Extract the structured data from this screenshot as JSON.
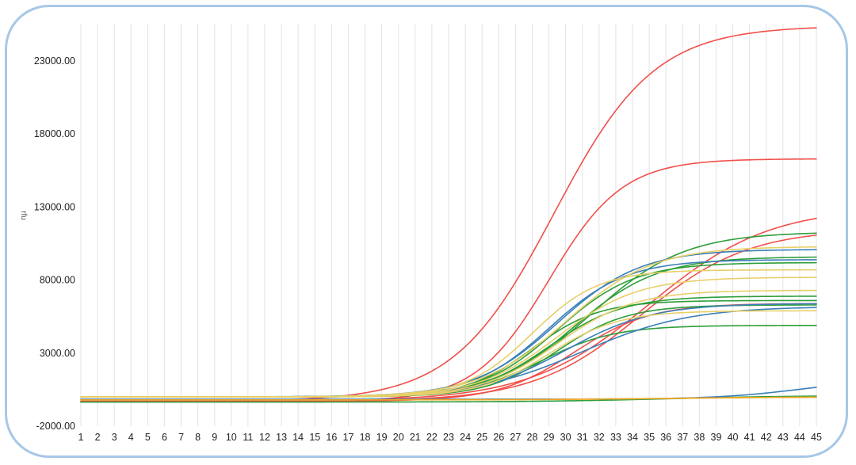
{
  "chart_data": {
    "type": "line",
    "title": "",
    "xlabel": "",
    "ylabel": "rfu",
    "xlim": [
      1,
      45
    ],
    "ylim": [
      -2000,
      25000
    ],
    "y_ticks": [
      "23000.00",
      "18000.00",
      "13000.00",
      "8000.00",
      "3000.00",
      "-2000.00"
    ],
    "x_ticks": [
      "1",
      "2",
      "3",
      "4",
      "5",
      "6",
      "7",
      "8",
      "9",
      "10",
      "11",
      "12",
      "13",
      "14",
      "15",
      "16",
      "17",
      "18",
      "19",
      "20",
      "21",
      "22",
      "23",
      "24",
      "25",
      "26",
      "27",
      "28",
      "29",
      "30",
      "31",
      "32",
      "33",
      "34",
      "35",
      "36",
      "37",
      "38",
      "39",
      "40",
      "41",
      "42",
      "43",
      "44",
      "45"
    ],
    "grid": "vertical",
    "curve_model": "sigmoid baseline/plateau/midpoint/slope per series",
    "series": [
      {
        "color": "#f0504a",
        "baseline": -300,
        "plateau": 25400,
        "midpoint": 29.3,
        "slope": 3.0
      },
      {
        "color": "#f0504a",
        "baseline": -300,
        "plateau": 16300,
        "midpoint": 29.0,
        "slope": 2.2
      },
      {
        "color": "#f0504a",
        "baseline": -300,
        "plateau": 13000,
        "midpoint": 35.0,
        "slope": 3.6
      },
      {
        "color": "#f0504a",
        "baseline": -300,
        "plateau": 11500,
        "midpoint": 34.5,
        "slope": 3.2
      },
      {
        "color": "#f0504a",
        "baseline": -300,
        "plateau": 6400,
        "midpoint": 30.5,
        "slope": 2.3
      },
      {
        "color": "#2e9e3a",
        "baseline": 0,
        "plateau": 11300,
        "midpoint": 31.5,
        "slope": 2.8
      },
      {
        "color": "#2e9e3a",
        "baseline": 0,
        "plateau": 9600,
        "midpoint": 30.5,
        "slope": 2.5
      },
      {
        "color": "#2e9e3a",
        "baseline": 0,
        "plateau": 9200,
        "midpoint": 29.5,
        "slope": 2.3
      },
      {
        "color": "#2e9e3a",
        "baseline": 0,
        "plateau": 6900,
        "midpoint": 29.0,
        "slope": 2.2
      },
      {
        "color": "#2e9e3a",
        "baseline": 0,
        "plateau": 6600,
        "midpoint": 28.0,
        "slope": 2.0
      },
      {
        "color": "#2e9e3a",
        "baseline": 0,
        "plateau": 6300,
        "midpoint": 29.5,
        "slope": 2.1
      },
      {
        "color": "#2e9e3a",
        "baseline": 0,
        "plateau": 4900,
        "midpoint": 28.5,
        "slope": 2.2
      },
      {
        "color": "#2e9e3a",
        "baseline": -350,
        "plateau": 100,
        "midpoint": 36.0,
        "slope": 4.0
      },
      {
        "color": "#3a7fb8",
        "baseline": 0,
        "plateau": 10100,
        "midpoint": 29.5,
        "slope": 2.5
      },
      {
        "color": "#3a7fb8",
        "baseline": 0,
        "plateau": 9400,
        "midpoint": 29.0,
        "slope": 2.3
      },
      {
        "color": "#3a7fb8",
        "baseline": 0,
        "plateau": 6400,
        "midpoint": 30.0,
        "slope": 2.6
      },
      {
        "color": "#3a7fb8",
        "baseline": 0,
        "plateau": 6200,
        "midpoint": 31.0,
        "slope": 3.2
      },
      {
        "color": "#3a7fb8",
        "baseline": -150,
        "plateau": 1200,
        "midpoint": 44.0,
        "slope": 2.5
      },
      {
        "color": "#e8cf6a",
        "baseline": 0,
        "plateau": 10300,
        "midpoint": 30.0,
        "slope": 2.6
      },
      {
        "color": "#e8cf6a",
        "baseline": 0,
        "plateau": 8700,
        "midpoint": 28.0,
        "slope": 2.0
      },
      {
        "color": "#e8cf6a",
        "baseline": 0,
        "plateau": 8200,
        "midpoint": 29.5,
        "slope": 2.4
      },
      {
        "color": "#e8cf6a",
        "baseline": 0,
        "plateau": 7300,
        "midpoint": 29.5,
        "slope": 2.3
      },
      {
        "color": "#e8cf6a",
        "baseline": 0,
        "plateau": 5900,
        "midpoint": 29.0,
        "slope": 2.1
      },
      {
        "color": "#e8cf6a",
        "baseline": -200,
        "plateau": 0,
        "midpoint": 36.0,
        "slope": 4.0
      },
      {
        "color": "#f5a623",
        "baseline": -200,
        "plateau": 0,
        "midpoint": 36.0,
        "slope": 4.0
      }
    ]
  }
}
